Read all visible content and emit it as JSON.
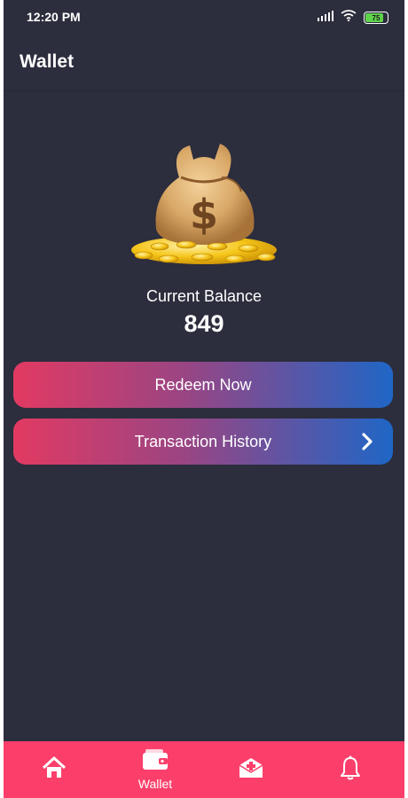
{
  "status_bar": {
    "time": "12:20 PM",
    "battery": "75",
    "icons": [
      "signal-icon",
      "wifi-icon",
      "battery-icon"
    ]
  },
  "header": {
    "title": "Wallet"
  },
  "balance": {
    "label": "Current Balance",
    "value": "849",
    "image": "moneybag-icon"
  },
  "actions": {
    "redeem_label": "Redeem Now",
    "history_label": "Transaction History"
  },
  "bottom_nav": {
    "items": [
      {
        "icon": "home-icon",
        "label": ""
      },
      {
        "icon": "wallet-icon",
        "label": "Wallet",
        "active": true
      },
      {
        "icon": "mail-icon",
        "label": ""
      },
      {
        "icon": "bell-icon",
        "label": ""
      }
    ]
  },
  "colors": {
    "background": "#2c2d3d",
    "accent": "#fb3f6a",
    "gradient_start": "#e23a62",
    "gradient_end": "#1f66c6"
  }
}
